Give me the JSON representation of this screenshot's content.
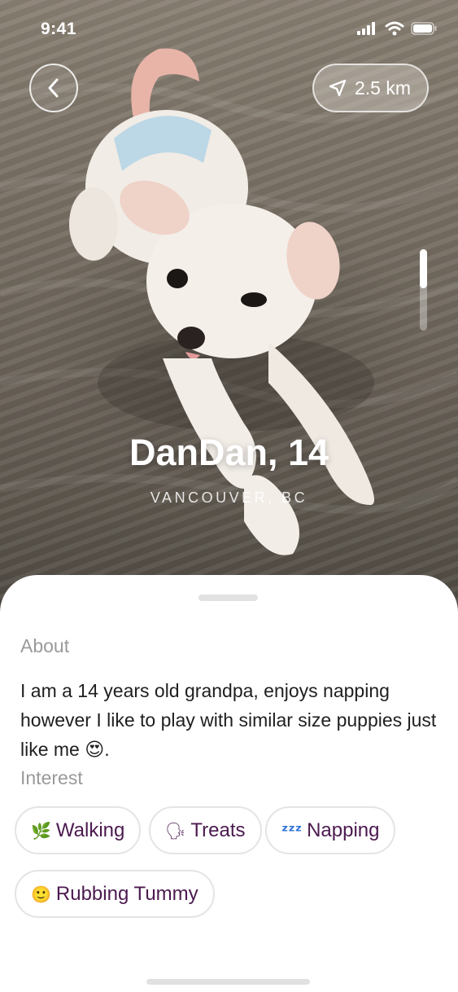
{
  "status_bar": {
    "time": "9:41"
  },
  "header": {
    "back_icon": "chevron-left-icon",
    "distance_icon": "navigation-arrow-icon",
    "distance": "2.5 km"
  },
  "profile": {
    "name": "DanDan, 14",
    "location": "VANCOUVER, BC"
  },
  "about": {
    "label": "About",
    "text": "I am a 14 years old grandpa, enjoys napping however I like to play with similar size puppies just like me 😍."
  },
  "interest": {
    "label": "Interest",
    "chips": [
      {
        "emoji": "🌿",
        "label": "Walking"
      },
      {
        "emoji": "🗣",
        "label": "Treats"
      },
      {
        "emoji": "ᶻᶻᶻ",
        "label": "Napping"
      },
      {
        "emoji": "🙂",
        "label": "Rubbing Tummy"
      }
    ]
  },
  "colors": {
    "chip_text": "#4b1a4f",
    "label_gray": "#9a9a9a",
    "body_text": "#1f1f1f"
  }
}
